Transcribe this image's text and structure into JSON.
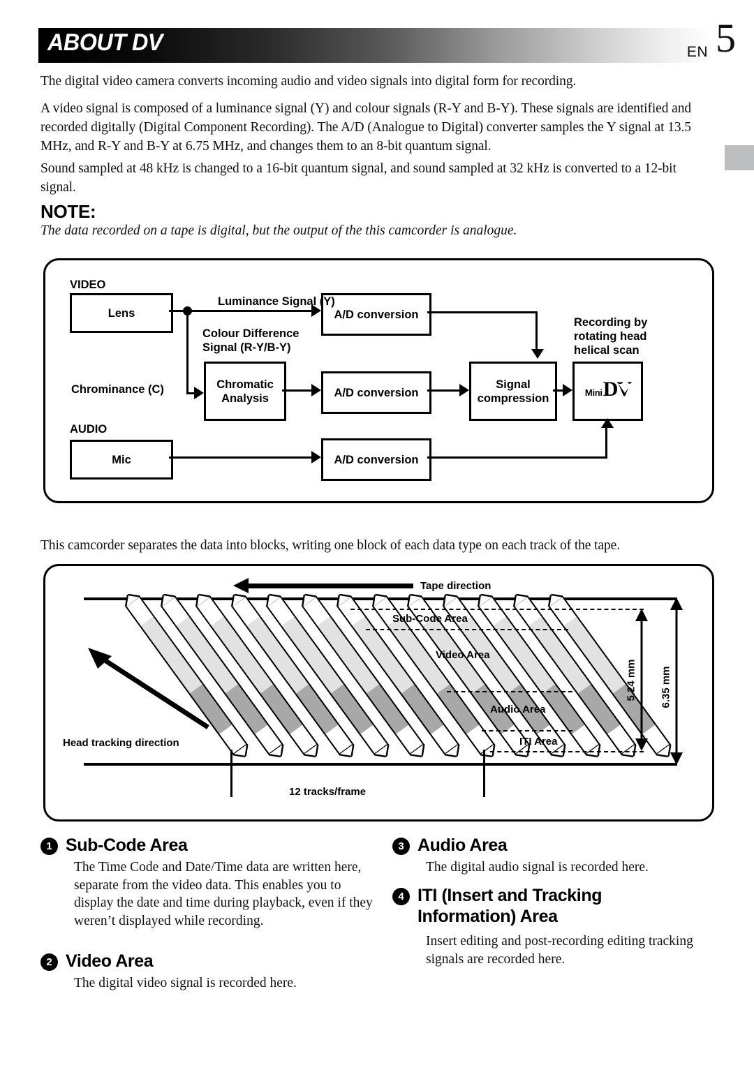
{
  "header": {
    "title": "ABOUT DV",
    "lang_code": "EN",
    "page_number": "5"
  },
  "edge_tab": {
    "color": "#bdbec0"
  },
  "paragraphs": {
    "p1": "The digital video camera converts incoming audio and video signals into digital form for recording.",
    "p2": "A video signal is composed of a luminance signal (Y) and colour signals (R-Y and B-Y). These signals are identified and recorded digitally (Digital Component Recording). The A/D (Analogue to Digital) converter samples the Y signal at 13.5 MHz, and R-Y and B-Y at 6.75 MHz, and changes them to an 8-bit quantum signal.",
    "p3": "Sound sampled at 48 kHz is changed to a 16-bit quantum signal, and sound sampled at 32 kHz is converted to a 12-bit signal.",
    "p4": "This camcorder separates the data into blocks, writing one block of each data type on each track of the tape."
  },
  "note": {
    "heading": "NOTE:",
    "text": "The data recorded on a tape is digital, but the output of the this camcorder is analogue."
  },
  "signal_diagram": {
    "section_video": "VIDEO",
    "section_audio": "AUDIO",
    "boxes": {
      "lens": "Lens",
      "mic": "Mic",
      "chromatic_analysis": "Chromatic\nAnalysis",
      "ad_conversion": "A/D\nconversion",
      "signal_compression": "Signal\ncompression"
    },
    "labels": {
      "luminance": "Luminance Signal (Y)",
      "colour_difference": "Colour Difference\nSignal (R-Y/B-Y)",
      "chrominance": "Chrominance (C)",
      "recording": "Recording by\nrotating head\nhelical scan"
    },
    "dv_logo": {
      "mini": "Mini",
      "dv": "DV"
    }
  },
  "tape_diagram": {
    "tape_direction": "Tape direction",
    "head_tracking": "Head tracking direction",
    "tracks_per_frame": "12 tracks/frame",
    "areas": [
      "Sub-Code Area",
      "Video Area",
      "Audio Area",
      "ITI Area"
    ],
    "dimension_inner": "5.24 mm",
    "dimension_outer": "6.35 mm",
    "track_count": 13,
    "colors": {
      "sub_code": "#ffffff",
      "video": "#e2e2e2",
      "audio": "#a8a8a8",
      "iti": "#ffffff"
    }
  },
  "sections": [
    {
      "number": "1",
      "title": "Sub-Code Area",
      "body": "The Time Code and Date/Time data are written here, separate from the video data. This enables you to display the date and time during playback, even if they weren’t displayed while recording."
    },
    {
      "number": "2",
      "title": "Video Area",
      "body": "The digital video signal is recorded here."
    },
    {
      "number": "3",
      "title": "Audio Area",
      "body": "The digital audio signal is recorded here."
    },
    {
      "number": "4",
      "title": "ITI (Insert and Tracking Information) Area",
      "body": "Insert editing and post-recording editing tracking signals are recorded here."
    }
  ]
}
